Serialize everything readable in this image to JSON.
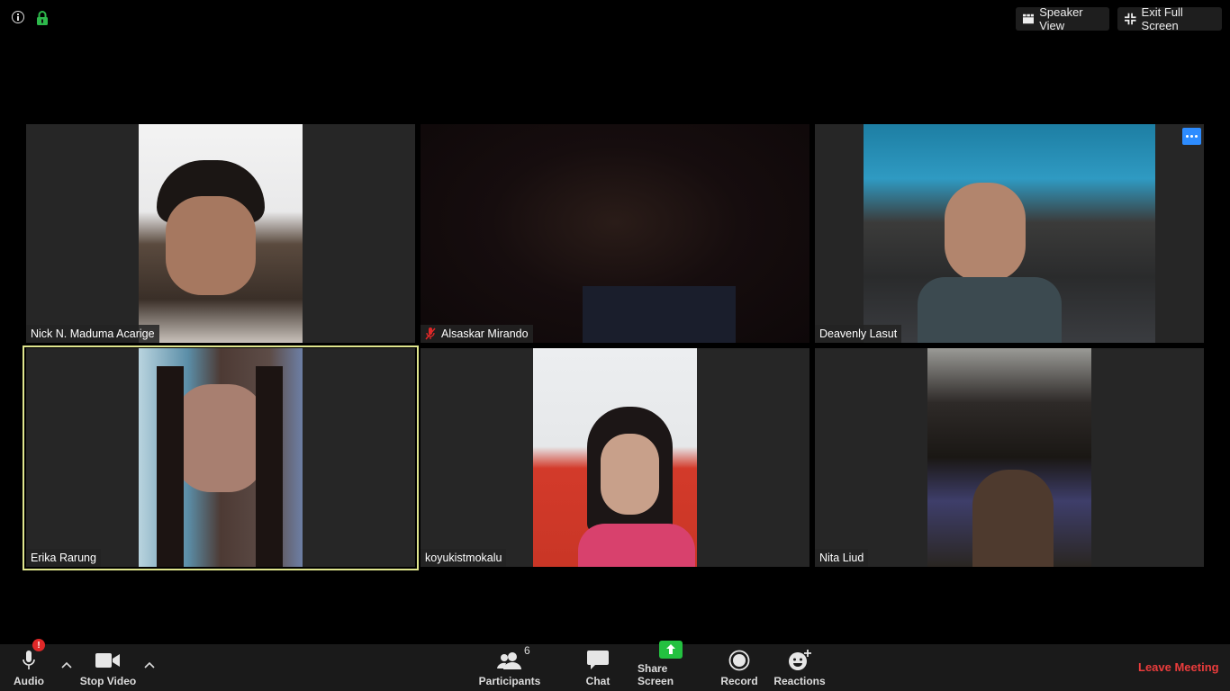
{
  "top_bar": {
    "speaker_view_label": "Speaker View",
    "exit_full_screen_label": "Exit Full Screen",
    "lock_color": "#2db84b"
  },
  "participants": [
    {
      "name": "Nick N. Maduma Acarige",
      "muted": false,
      "active": false
    },
    {
      "name": "Alsaskar Mirando",
      "muted": true,
      "active": false
    },
    {
      "name": "Deavenly Lasut",
      "muted": false,
      "active": false
    },
    {
      "name": "Erika Rarung",
      "muted": false,
      "active": true
    },
    {
      "name": "koyukistmokalu",
      "muted": false,
      "active": false
    },
    {
      "name": "Nita Liud",
      "muted": false,
      "active": false
    }
  ],
  "toolbar": {
    "audio_label": "Audio",
    "audio_badge": "!",
    "stop_video_label": "Stop Video",
    "participants_label": "Participants",
    "participants_count": "6",
    "chat_label": "Chat",
    "share_screen_label": "Share Screen",
    "record_label": "Record",
    "reactions_label": "Reactions",
    "leave_label": "Leave Meeting"
  },
  "colors": {
    "active_speaker_border": "#dfe58d",
    "share_green": "#23c140",
    "leave_red": "#ea3c3c",
    "more_button_blue": "#2d8cff"
  }
}
